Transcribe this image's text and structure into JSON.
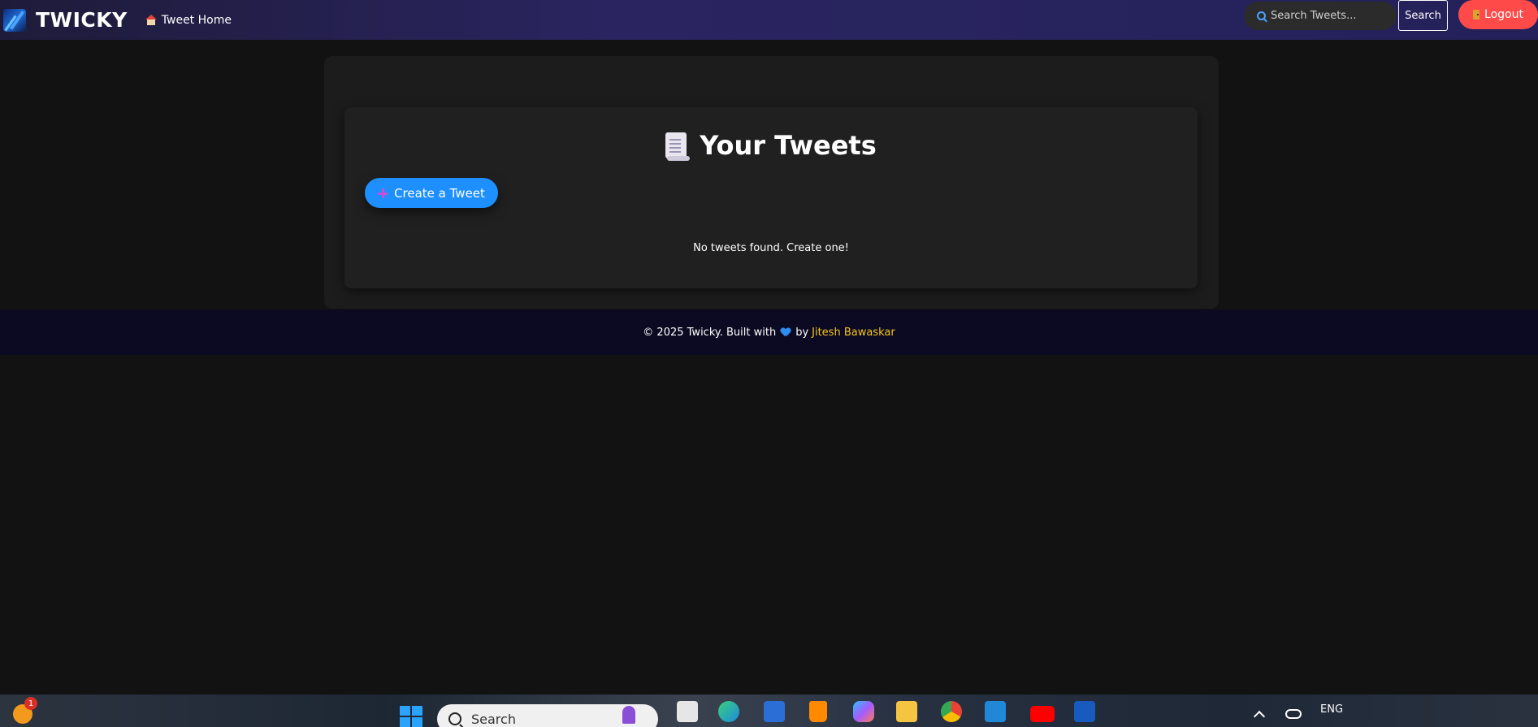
{
  "navbar": {
    "brand": "TWICKY",
    "home_link": "Tweet Home",
    "search_placeholder": "Search Tweets...",
    "search_button": "Search",
    "logout_button": "Logout"
  },
  "main": {
    "title": "Your Tweets",
    "create_button": "Create a Tweet",
    "empty_message": "No tweets found. Create one!"
  },
  "footer": {
    "text_prefix": "© 2025 Twicky. Built with",
    "text_by": "by",
    "author": "Jitesh Bawaskar"
  },
  "taskbar": {
    "notification_count": "1",
    "search_label": "Search",
    "language": "ENG"
  },
  "colors": {
    "accent_blue": "#1e8fff",
    "logout_red": "#ff4a4a",
    "author_gold": "#f5c518",
    "background": "#121212"
  }
}
